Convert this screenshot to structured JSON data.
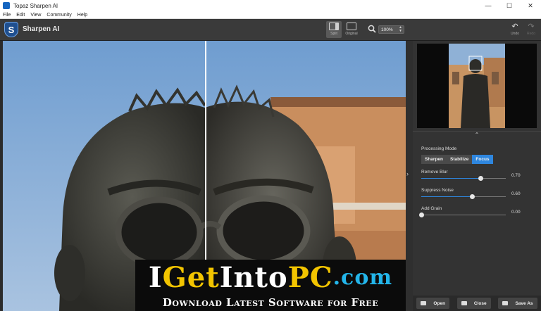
{
  "window": {
    "title": "Topaz Sharpen AI",
    "controls": {
      "minimize": "—",
      "maximize": "☐",
      "close": "✕"
    }
  },
  "menu": {
    "items": [
      "File",
      "Edit",
      "View",
      "Community",
      "Help"
    ]
  },
  "toolbar": {
    "logo_letter": "S",
    "app_name": "Sharpen AI",
    "split_label": "Split",
    "original_label": "Original",
    "zoom_value": "100%",
    "undo_label": "Undo",
    "redo_label": "Redo"
  },
  "panel": {
    "processing_mode_label": "Processing Mode",
    "modes": [
      "Sharpen",
      "Stabilize",
      "Focus"
    ],
    "active_mode": "Focus",
    "sliders": [
      {
        "label": "Remove Blur",
        "value": "0.70",
        "level": 0.7
      },
      {
        "label": "Suppress Noise",
        "value": "0.60",
        "level": 0.6
      },
      {
        "label": "Add Grain",
        "value": "0.00",
        "level": 0.0
      }
    ],
    "buttons": {
      "open": "Open",
      "close": "Close",
      "save_as": "Save As"
    }
  },
  "banner": {
    "line1_parts": [
      "I",
      "Get",
      "Into",
      "PC",
      ".com"
    ],
    "line2": "Download Latest Software for Free"
  },
  "colors": {
    "accent": "#2e86de",
    "banner_yellow": "#f2c400",
    "banner_cyan": "#23b5ea"
  }
}
